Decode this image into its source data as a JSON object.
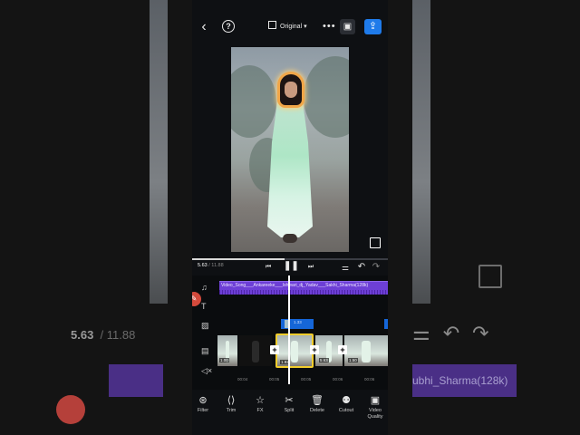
{
  "topbar": {
    "ratio_label": "Original",
    "icons": [
      "back-icon",
      "help-icon",
      "aspect-ratio-icon",
      "more-icon",
      "save-icon",
      "export-icon"
    ]
  },
  "playback": {
    "current_time": "5.63",
    "total_time": "/ 11.88",
    "progress": 0.474
  },
  "audio_track": {
    "label": "Video_Song___Ankareeke___Ishwari_dj_Yadav___Sakhi_Sharma(128k)"
  },
  "overlay_clip": {
    "label": "1.33"
  },
  "video_strip": {
    "selected_duration": "1.92",
    "durations": [
      "1.00",
      "5.63",
      "1.50"
    ]
  },
  "ruler": {
    "ticks": [
      "00:04",
      "00:05",
      "00:05",
      "00:06",
      "00:06"
    ]
  },
  "toolbar": {
    "items": [
      {
        "label": "Filter",
        "icon": "filter-icon"
      },
      {
        "label": "Trim",
        "icon": "trim-icon"
      },
      {
        "label": "FX",
        "icon": "fx-icon"
      },
      {
        "label": "Split",
        "icon": "split-icon"
      },
      {
        "label": "Delete",
        "icon": "delete-icon"
      },
      {
        "label": "Cutout",
        "icon": "cutout-icon"
      },
      {
        "label": "Video Quality",
        "icon": "video-quality-icon"
      }
    ]
  },
  "background_ghost": {
    "current_time": "5.63",
    "total_time": "/ 11.88",
    "audio_label": "ubhi_Sharma(128k)"
  },
  "colors": {
    "accent": "#1f7bea",
    "audio": "#6d3fd6",
    "selection": "#f2cd2c",
    "overlay": "#1566d8"
  }
}
